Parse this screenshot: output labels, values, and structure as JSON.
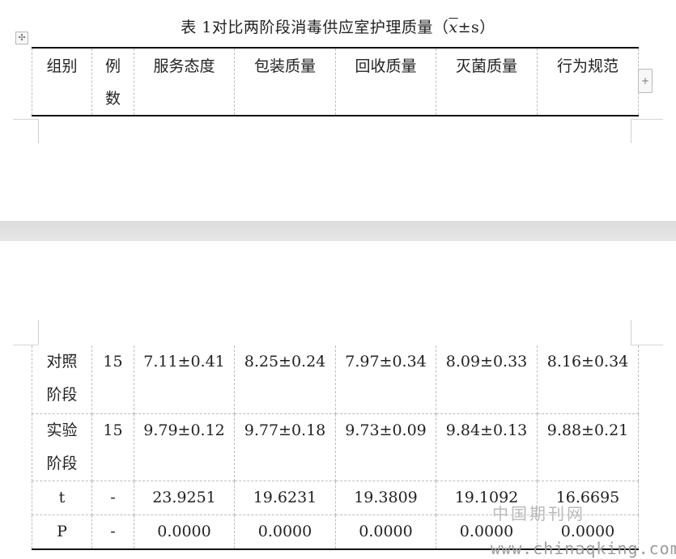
{
  "title": {
    "prefix": "表 1对比两阶段消毒供应室护理质量（",
    "xbar": "x",
    "suffix": "±s）"
  },
  "table": {
    "headers": [
      {
        "lines": [
          "组别"
        ]
      },
      {
        "lines": [
          "例",
          "数"
        ]
      },
      {
        "lines": [
          "服务态度"
        ]
      },
      {
        "lines": [
          "包装质量"
        ]
      },
      {
        "lines": [
          "回收质量"
        ]
      },
      {
        "lines": [
          "灭菌质量"
        ]
      },
      {
        "lines": [
          "行为规范"
        ]
      }
    ],
    "rows": [
      {
        "group": [
          "对照",
          "阶段"
        ],
        "n": "15",
        "values": [
          "7.11±0.41",
          "8.25±0.24",
          "7.97±0.34",
          "8.09±0.33",
          "8.16±0.34"
        ]
      },
      {
        "group": [
          "实验",
          "阶段"
        ],
        "n": "15",
        "values": [
          "9.79±0.12",
          "9.77±0.18",
          "9.73±0.09",
          "9.84±0.13",
          "9.88±0.21"
        ]
      },
      {
        "group": [
          "t"
        ],
        "n": "-",
        "values": [
          "23.9251",
          "19.6231",
          "19.3809",
          "19.1092",
          "16.6695"
        ]
      },
      {
        "group": [
          "P"
        ],
        "n": "-",
        "values": [
          "0.0000",
          "0.0000",
          "0.0000",
          "0.0000",
          "0.0000"
        ]
      }
    ]
  },
  "controls": {
    "move_icon": "✣",
    "add_column_icon": "+"
  },
  "watermark": {
    "cn": "中国期刊网",
    "en": "www.chinaqking.com"
  }
}
